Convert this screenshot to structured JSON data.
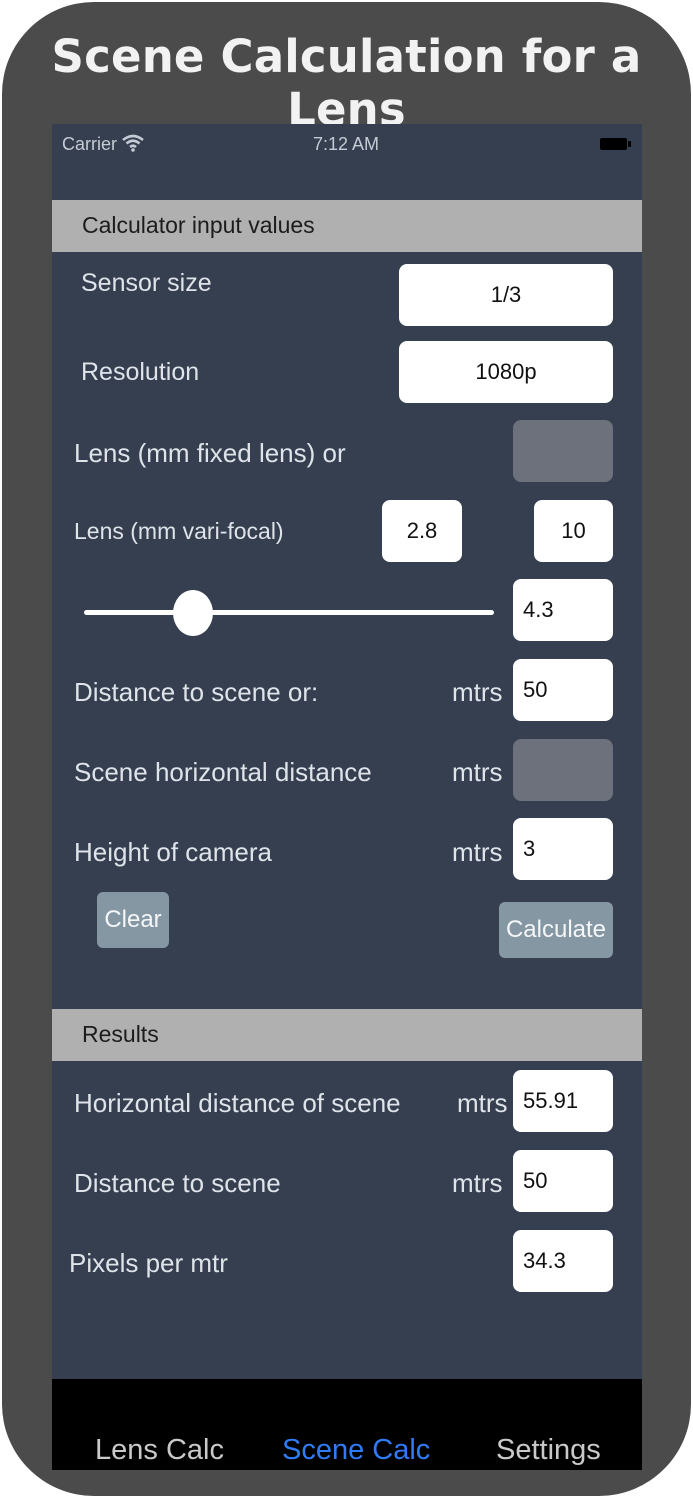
{
  "banner": {
    "title": "Scene Calculation for a Lens"
  },
  "status_bar": {
    "carrier": "Carrier",
    "time": "7:12 AM"
  },
  "input_section": {
    "header": "Calculator input values",
    "sensor_size": {
      "label": "Sensor size",
      "value": "1/3"
    },
    "resolution": {
      "label": "Resolution",
      "value": "1080p"
    },
    "fixed_lens": {
      "label": "Lens (mm fixed lens) or",
      "value": ""
    },
    "varifocal": {
      "label": "Lens (mm vari-focal)",
      "min": "2.8",
      "max": "10"
    },
    "focal_slider": {
      "value": "4.3",
      "fraction": 0.24
    },
    "distance": {
      "label": "Distance to scene or:",
      "unit": "mtrs",
      "value": "50"
    },
    "scene_horizontal": {
      "label": "Scene horizontal distance",
      "unit": "mtrs",
      "value": ""
    },
    "camera_height": {
      "label": "Height of camera",
      "unit": "mtrs",
      "value": "3"
    },
    "clear_button": "Clear",
    "calculate_button": "Calculate"
  },
  "results_section": {
    "header": "Results",
    "horizontal_distance": {
      "label": "Horizontal distance of scene",
      "unit": "mtrs",
      "value": "55.91"
    },
    "distance": {
      "label": "Distance to scene",
      "unit": "mtrs",
      "value": "50"
    },
    "pixels_per_mtr": {
      "label": "Pixels per mtr",
      "value": "34.3"
    }
  },
  "tab_bar": {
    "tabs": [
      {
        "label": "Lens Calc",
        "active": false
      },
      {
        "label": "Scene Calc",
        "active": true
      },
      {
        "label": "Settings",
        "active": false
      }
    ],
    "active_color": "#2f7bf6"
  },
  "colors": {
    "background": "#353f4f",
    "frame": "#4b4b4b",
    "section_header": "#b0b0b0",
    "button": "#8597a3"
  }
}
